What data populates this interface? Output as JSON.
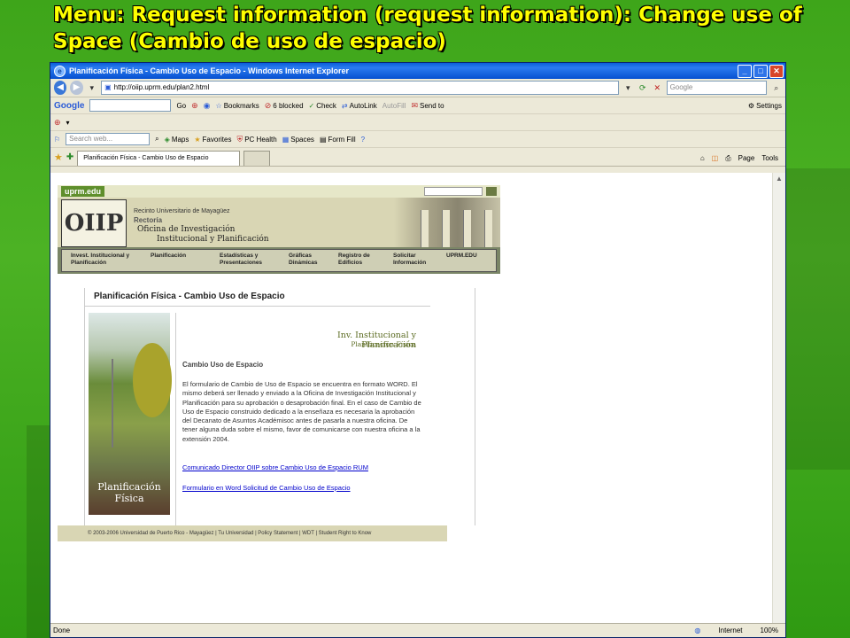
{
  "slide": {
    "title": "Menu: Request information (request information): Change use of Space (Cambio de uso de espacio)"
  },
  "browser": {
    "title": "Planificación Física - Cambio Uso de Espacio - Windows Internet Explorer",
    "url": "http://oiip.uprm.edu/plan2.html",
    "search_placeholder": "Google",
    "toolbar1": {
      "google": "Google",
      "go": "Go",
      "bookmarks": "Bookmarks",
      "blocked": "6 blocked",
      "check": "Check",
      "autolink": "AutoLink",
      "autofill": "AutoFill",
      "sendto": "Send to",
      "settings": "Settings"
    },
    "toolbar3": {
      "search_placeholder": "Search web...",
      "maps": "Maps",
      "favorites": "Favorites",
      "pchealth": "PC Health",
      "spaces": "Spaces",
      "formfill": "Form Fill"
    },
    "tab": {
      "label": "Planificación Física - Cambio Uso de Espacio",
      "page": "Page",
      "tools": "Tools"
    },
    "status": {
      "left": "Done",
      "zone": "Internet",
      "zoom": "100%"
    }
  },
  "site": {
    "logo": "uprm.edu",
    "oiip_logo": "OIIP",
    "banner": {
      "line1": "Recinto Universitario de Mayagüez",
      "line2": "Rectoría",
      "line3": "Oficina de Investigación",
      "line4": "Institucional y Planificación"
    },
    "menu": [
      {
        "label": "Invest. Institucional y Planificación"
      },
      {
        "label": "Planificación"
      },
      {
        "label": "Estadísticas y Presentaciones"
      },
      {
        "label": "Gráficas Dinámicas"
      },
      {
        "label": "Registro de Edificios"
      },
      {
        "label": "Solicitar Información"
      },
      {
        "label": "UPRM.EDU"
      }
    ],
    "page_title": "Planificación Física - Cambio Uso de Espacio",
    "photo_caption_1": "Planificación",
    "photo_caption_2": "Física",
    "inv_title": "Inv. Institucional y Planificación",
    "inv_sub": "Planificación Física",
    "heading": "Cambio Uso de Espacio",
    "body": "El formulario de Cambio de Uso de Espacio se encuentra en formato WORD. El mismo deberá ser llenado y enviado a la Oficina de Investigación Institucional y Planificación para su aprobación o desaprobación final. En el caso de Cambio de Uso de Espacio construido dedicado a la enseñaza es necesaria la aprobación del Decanato de Asuntos Académisoc antes de pasarla a nuestra oficina. De tener alguna duda sobre el mismo, favor de comunicarse con nuestra oficina a la extensión 2004.",
    "link1": "Comunicado Director OIIP sobre Cambio Uso de Espacio RUM",
    "link2": "Formulario en Word Solicitud de Cambio Uso de Espacio",
    "footer": "© 2003-2006 Universidad de Puerto Rico - Mayagüez | Tu Universidad | Policy Statement | WDT | Student Right to Know"
  }
}
